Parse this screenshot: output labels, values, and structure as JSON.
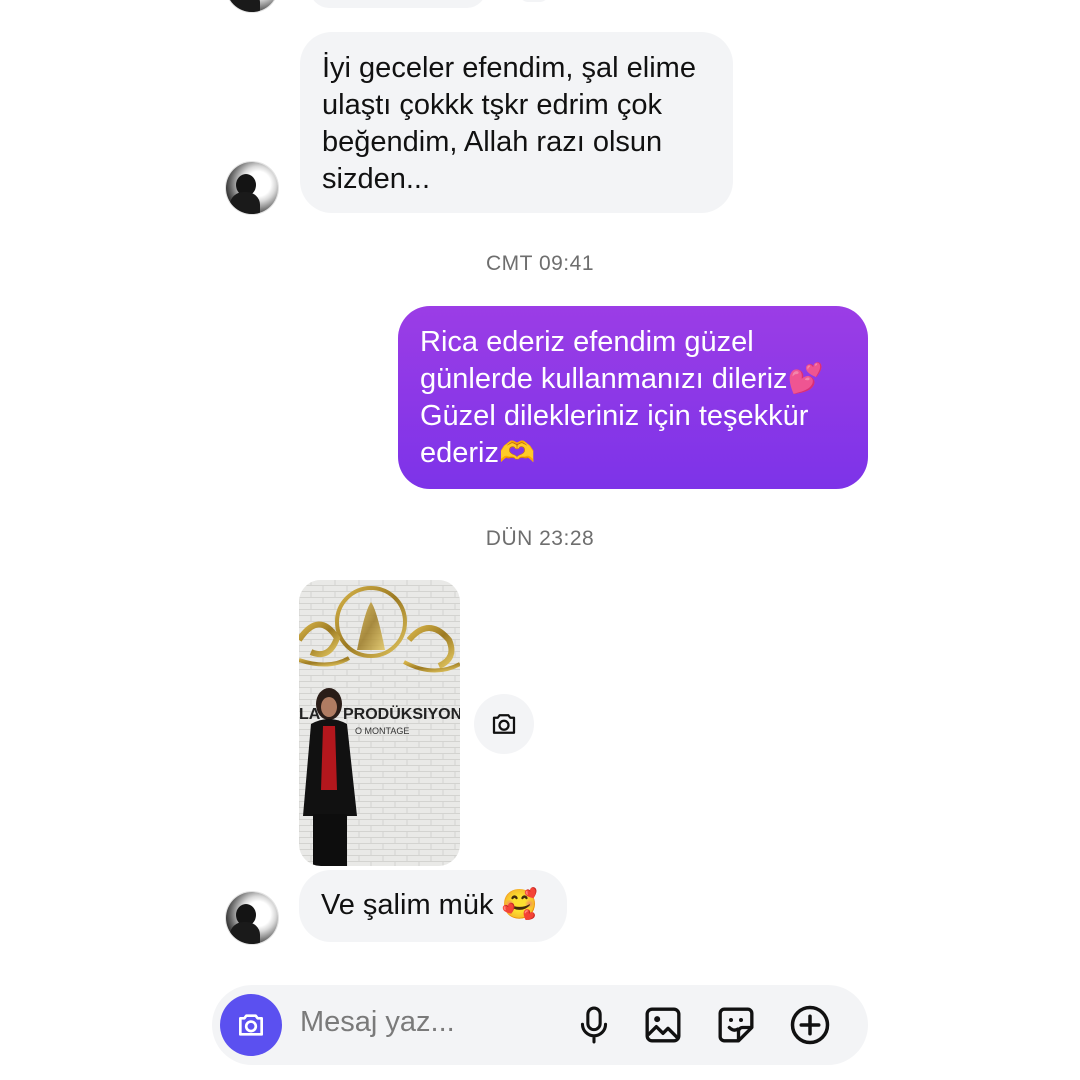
{
  "messages": [
    {
      "id": "m1",
      "direction": "incoming",
      "lines": [
        "İyi geceler efendim, şal elime",
        "ulaştı çokkk tşkr edrim çok",
        "beğendim, Allah razı olsun",
        "sizden..."
      ]
    },
    {
      "id": "m2",
      "direction": "outgoing",
      "timestamp": "CMT 09:41",
      "lines": [
        "Rica ederiz efendim güzel",
        "günlerde kullanmanızı dileriz💕",
        "Güzel dilekleriniz için teşekkür",
        "ederiz🫶"
      ]
    },
    {
      "id": "m3",
      "direction": "incoming",
      "timestamp": "DÜN 23:28",
      "photo": {
        "sign_text": "PRODÜKSIYON",
        "sign_subtext": "O MONTAGE",
        "sign_prefix": "LA"
      },
      "text": "Ve şalim mük 🥰"
    }
  ],
  "composer": {
    "placeholder": "Mesaj yaz...",
    "icons": [
      "camera-icon",
      "microphone-icon",
      "gallery-icon",
      "sticker-icon",
      "add-icon"
    ]
  },
  "colors": {
    "outgoing_bubble_top": "#9b3de6",
    "outgoing_bubble_bottom": "#7d33e8",
    "incoming_bubble": "#f3f4f6",
    "camera_button": "#5b50f0"
  }
}
